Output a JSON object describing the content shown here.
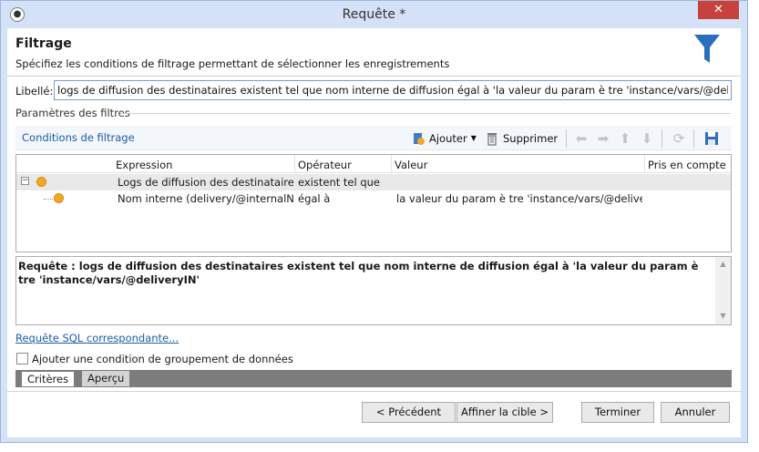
{
  "window": {
    "title": "Requête *",
    "close_glyph": "✕"
  },
  "header": {
    "title": "Filtrage",
    "subtitle": "Spécifiez les conditions de filtrage permettant de sélectionner les enregistrements",
    "icon": "funnel-icon"
  },
  "label_field": {
    "label": "Libellé:",
    "value": "logs de diffusion des destinataires existent tel que nom interne de diffusion égal à 'la valeur du param è tre 'instance/vars/@deliveryIN'"
  },
  "params_section": {
    "title": "Paramètres des filtres"
  },
  "toolbar": {
    "conditions_link": "Conditions de filtrage",
    "add_label": "Ajouter",
    "delete_label": "Supprimer"
  },
  "grid": {
    "columns": [
      "Expression",
      "Opérateur",
      "Valeur",
      "Pris en compte s"
    ],
    "rows": [
      {
        "expression": "Logs de diffusion des destinataires ...",
        "operator": "existent tel que",
        "value": ""
      },
      {
        "expression": "Nom interne (delivery/@internalName)",
        "operator": "égal à",
        "value": "la valeur du param è tre 'instance/vars/@deliveryIN"
      }
    ]
  },
  "query": {
    "text": "Requête : logs de diffusion des destinataires existent tel que nom interne de diffusion égal à 'la valeur du param è tre 'instance/vars/@deliveryIN'"
  },
  "sql_link": "Requête SQL correspondante...",
  "grouping_checkbox": {
    "label": "Ajouter une condition de groupement de données",
    "checked": false
  },
  "tabs": [
    "Critères",
    "Aperçu"
  ],
  "buttons": {
    "previous": "< Précédent",
    "refine": "Affiner la cible >",
    "finish": "Terminer",
    "cancel": "Annuler"
  },
  "colors": {
    "accent_blue": "#1b5ca8",
    "tree_dot": "#f5a623",
    "funnel": "#2a6fbe",
    "close_red": "#c7423d"
  }
}
